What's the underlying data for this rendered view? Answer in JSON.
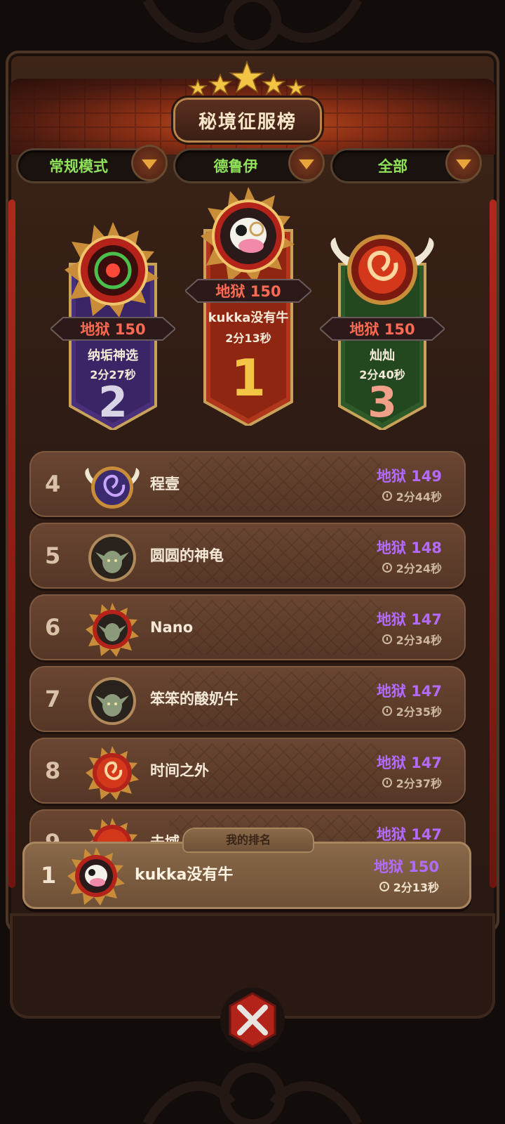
{
  "title": "秘境征服榜",
  "filters": [
    {
      "label": "常规模式"
    },
    {
      "label": "德鲁伊"
    },
    {
      "label": "全部"
    }
  ],
  "podium": {
    "first": {
      "rank": "1",
      "score": "地狱 150",
      "name": "kukka没有牛",
      "time": "2分13秒"
    },
    "second": {
      "rank": "2",
      "score": "地狱 150",
      "name": "纳垢神选",
      "time": "2分27秒"
    },
    "third": {
      "rank": "3",
      "score": "地狱 150",
      "name": "灿灿",
      "time": "2分40秒"
    }
  },
  "rows": [
    {
      "rank": "4",
      "name": "程壹",
      "score": "地狱 149",
      "time": "2分44秒",
      "avatar": "purple-spiral-winged-icon"
    },
    {
      "rank": "5",
      "name": "圆圆的神龟",
      "score": "地狱 148",
      "time": "2分24秒",
      "avatar": "goblin-icon"
    },
    {
      "rank": "6",
      "name": "Nano",
      "score": "地狱 147",
      "time": "2分34秒",
      "avatar": "goblin-spiked-frame-icon"
    },
    {
      "rank": "7",
      "name": "笨笨的酸奶牛",
      "score": "地狱 147",
      "time": "2分35秒",
      "avatar": "goblin-icon"
    },
    {
      "rank": "8",
      "name": "时间之外",
      "score": "地狱 147",
      "time": "2分37秒",
      "avatar": "fire-vortex-spiked-icon"
    },
    {
      "rank": "9",
      "name": "未域",
      "score": "地狱 147",
      "time": "",
      "avatar": "fire-vortex-spiked-icon"
    }
  ],
  "my_rank": {
    "tab_label": "我的排名",
    "rank": "1",
    "name": "kukka没有牛",
    "score": "地狱 150",
    "time": "2分13秒"
  },
  "colors": {
    "score_purple": "#b36bff",
    "score_red": "#ff6a52",
    "filter_green": "#8fe25a",
    "gold": "#f2c544"
  }
}
